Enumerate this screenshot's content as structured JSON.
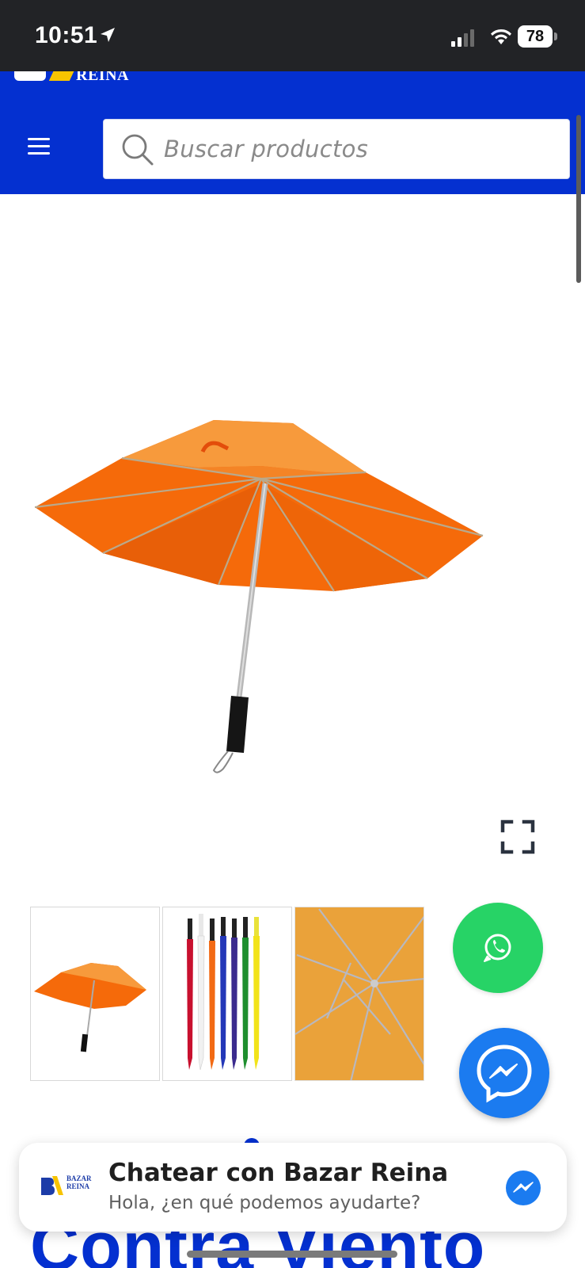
{
  "status_bar": {
    "time": "10:51",
    "battery": "78",
    "icons": [
      "location-arrow-icon",
      "signal-icon",
      "wifi-icon",
      "battery-icon"
    ]
  },
  "header": {
    "logo_text": "REINA",
    "search": {
      "placeholder": "Buscar productos",
      "value": ""
    },
    "colors": {
      "brand_blue": "#0430d0",
      "brand_yellow": "#f7c300"
    }
  },
  "product": {
    "title": "Contra Viento",
    "main_image": "orange-umbrella",
    "thumbnails": [
      {
        "alt": "Paraguas naranja"
      },
      {
        "alt": "Paraguas de colores"
      },
      {
        "alt": "Varillas del paraguas"
      }
    ],
    "gallery_index": 1
  },
  "floating": {
    "whatsapp_icon": "whatsapp-icon",
    "messenger_icon": "messenger-icon",
    "colors": {
      "whatsapp": "#27d366",
      "messenger": "#1b7bf0"
    }
  },
  "chat": {
    "logo_line1": "BAZAR",
    "logo_line2": "REINA",
    "title": "Chatear con Bazar Reina",
    "subtitle": "Hola, ¿en qué podemos ayudarte?"
  }
}
